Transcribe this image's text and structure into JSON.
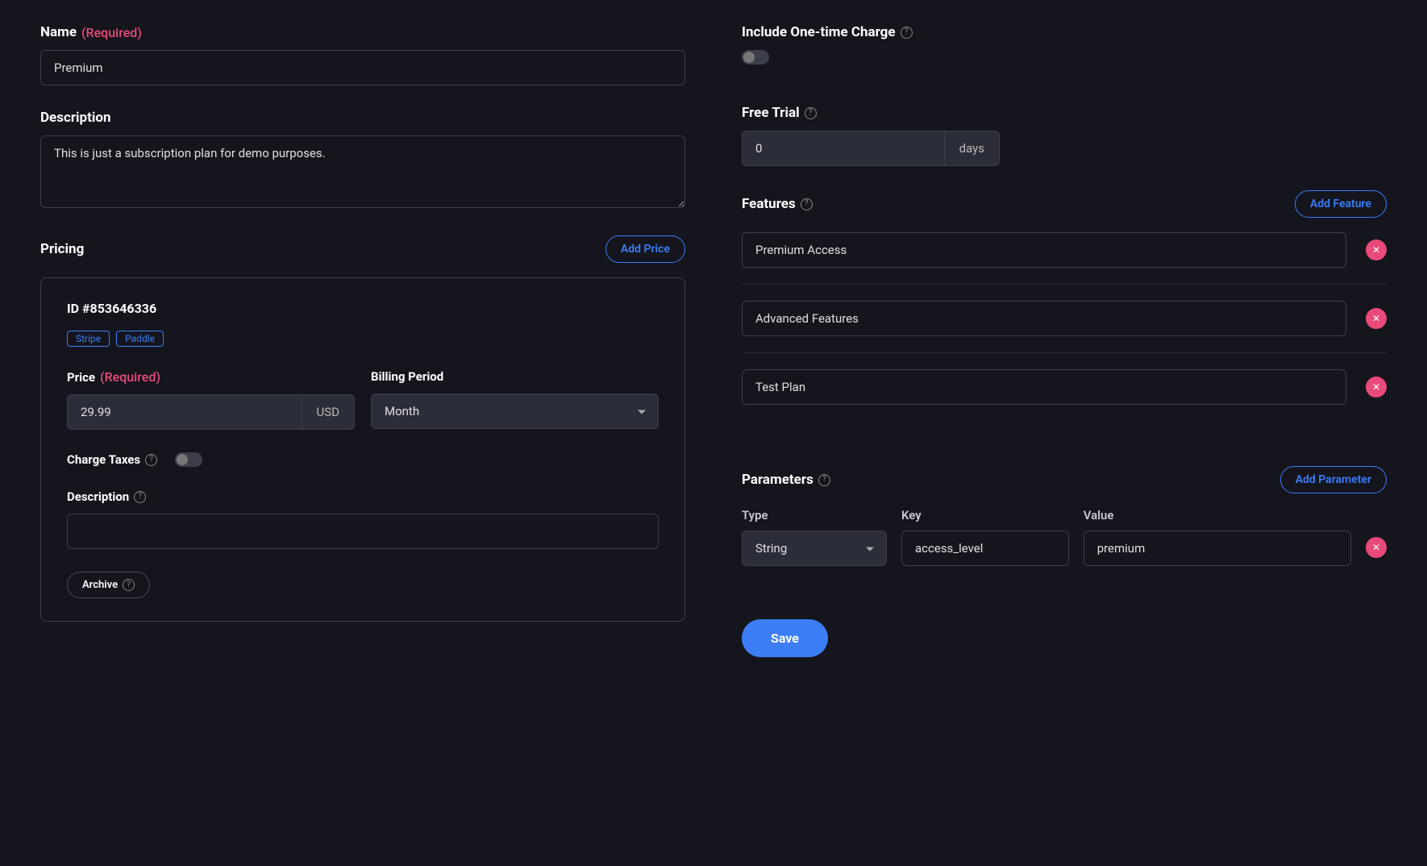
{
  "name": {
    "label": "Name",
    "required": "(Required)",
    "value": "Premium"
  },
  "description": {
    "label": "Description",
    "value": "This is just a subscription plan for demo purposes."
  },
  "pricing": {
    "title": "Pricing",
    "addBtn": "Add Price",
    "card": {
      "id": "ID #853646336",
      "tags": [
        "Stripe",
        "Paddle"
      ],
      "priceLabel": "Price",
      "required": "(Required)",
      "priceValue": "29.99",
      "currency": "USD",
      "periodLabel": "Billing Period",
      "periodValue": "Month",
      "taxesLabel": "Charge Taxes",
      "descLabel": "Description",
      "descValue": "",
      "archiveBtn": "Archive"
    }
  },
  "onetime": {
    "label": "Include One-time Charge"
  },
  "freeTrial": {
    "label": "Free Trial",
    "value": "0",
    "unit": "days"
  },
  "features": {
    "title": "Features",
    "addBtn": "Add Feature",
    "items": [
      "Premium Access",
      "Advanced Features",
      "Test Plan"
    ]
  },
  "parameters": {
    "title": "Parameters",
    "addBtn": "Add Parameter",
    "typeLabel": "Type",
    "keyLabel": "Key",
    "valueLabel": "Value",
    "items": [
      {
        "type": "String",
        "key": "access_level",
        "value": "premium"
      }
    ]
  },
  "saveBtn": "Save"
}
